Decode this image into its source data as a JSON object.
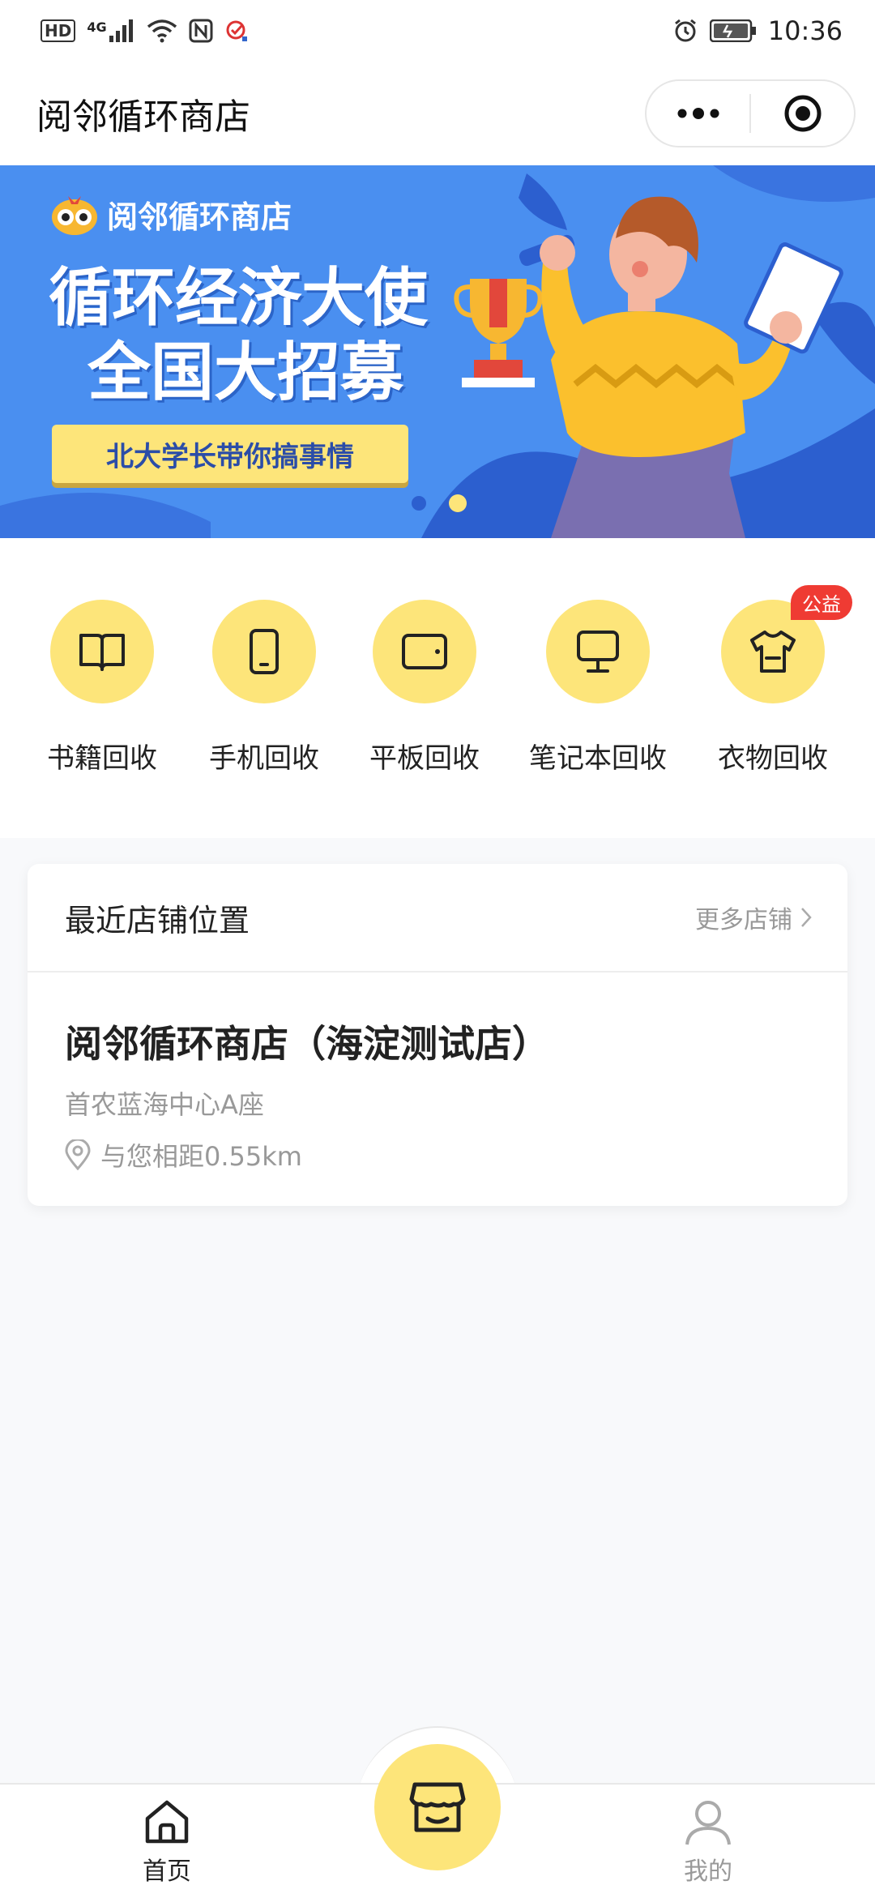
{
  "status_bar": {
    "left_badge": "HD",
    "network": "4G",
    "time": "10:36",
    "icons": [
      "hd-icon",
      "signal-icon",
      "wifi-icon",
      "nfc-icon",
      "app-notification-icon",
      "alarm-icon",
      "battery-icon"
    ]
  },
  "header": {
    "title": "阅邻循环商店",
    "menu_icon": "more-dots-icon",
    "close_icon": "target-close-icon"
  },
  "banner": {
    "logo_text": "阅邻循环商店",
    "headline_line1": "循环经济大使",
    "headline_line2": "全国大招募",
    "pill_text": "北大学长带你搞事情"
  },
  "categories": [
    {
      "label": "书籍回收",
      "icon": "book-icon"
    },
    {
      "label": "手机回收",
      "icon": "phone-icon"
    },
    {
      "label": "平板回收",
      "icon": "tablet-icon"
    },
    {
      "label": "笔记本回收",
      "icon": "laptop-icon"
    },
    {
      "label": "衣物回收",
      "icon": "clothes-icon",
      "badge": "公益"
    }
  ],
  "store_section": {
    "title": "最近店铺位置",
    "more_link": "更多店铺",
    "store": {
      "name": "阅邻循环商店（海淀测试店）",
      "address": "首农蓝海中心A座",
      "distance": "与您相距0.55km"
    }
  },
  "tab_bar": {
    "home": "首页",
    "mine": "我的",
    "center_icon": "store-icon"
  },
  "colors": {
    "accent_yellow": "#fde57a",
    "banner_blue": "#4a8ff0",
    "badge_red": "#ef3b33"
  }
}
